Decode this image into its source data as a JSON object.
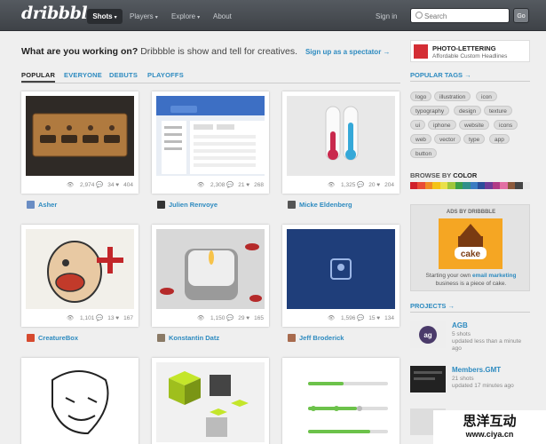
{
  "brand": {
    "logo": "dribbble"
  },
  "nav": {
    "shots": "Shots",
    "players": "Players",
    "explore": "Explore",
    "about": "About",
    "signin": "Sign in",
    "search_placeholder": "Search",
    "go": "Go"
  },
  "headline": {
    "bold": "What are you working on?",
    "text": "Dribbble is show and tell for creatives.",
    "link": "Sign up as a spectator →"
  },
  "tabs": [
    "POPULAR",
    "EVERYONE",
    "DEBUTS",
    "PLAYOFFS"
  ],
  "shots": [
    {
      "views": "2,974",
      "comments": "34",
      "likes": "404",
      "author": "Asher",
      "color": "#6a8dc4"
    },
    {
      "views": "2,308",
      "comments": "21",
      "likes": "268",
      "author": "Julien Renvoye",
      "color": "#333333"
    },
    {
      "views": "1,325",
      "comments": "20",
      "likes": "204",
      "author": "Micke Eldenberg",
      "color": "#555555"
    },
    {
      "views": "1,101",
      "comments": "13",
      "likes": "167",
      "author": "CreatureBox",
      "color": "#d64a2f"
    },
    {
      "views": "1,150",
      "comments": "29",
      "likes": "165",
      "author": "Konstantin Datz",
      "color": "#8a7a66"
    },
    {
      "views": "1,596",
      "comments": "15",
      "likes": "134",
      "author": "Jeff Broderick",
      "color": "#a86b4e"
    }
  ],
  "ad": {
    "title": "PHOTO-LETTERING",
    "subtitle": "Affordable Custom Headlines"
  },
  "sidebar": {
    "popular_tags": "POPULAR TAGS →",
    "tags": [
      "logo",
      "illustration",
      "icon",
      "typography",
      "design",
      "texture",
      "ui",
      "iphone",
      "website",
      "icons",
      "web",
      "vector",
      "type",
      "app",
      "button"
    ],
    "browse_prefix": "BROWSE BY",
    "browse_color": "COLOR",
    "colors": [
      "#d0202a",
      "#e94b35",
      "#f08a24",
      "#f4c316",
      "#e9e04a",
      "#9fc63b",
      "#3a9f48",
      "#2f8f8a",
      "#3a7bc2",
      "#2b4d9b",
      "#6f3b98",
      "#b13a86",
      "#e26fa3",
      "#8c5a3c",
      "#444444",
      "#e8e8e8"
    ],
    "ads_by": "ADS BY DRIBBBLE",
    "ads_text_1": "Starting your own",
    "ads_link": "email marketing",
    "ads_text_2": "business is a piece of cake.",
    "projects_title": "PROJECTS →",
    "projects": [
      {
        "name": "AGB",
        "shots": "5 shots",
        "updated": "updated less than a minute ago"
      },
      {
        "name": "Members.GMT",
        "shots": "21 shots",
        "updated": "updated 17 minutes ago"
      }
    ]
  },
  "watermark": {
    "line1": "思洋互动",
    "line2": "www.ciya.cn"
  }
}
